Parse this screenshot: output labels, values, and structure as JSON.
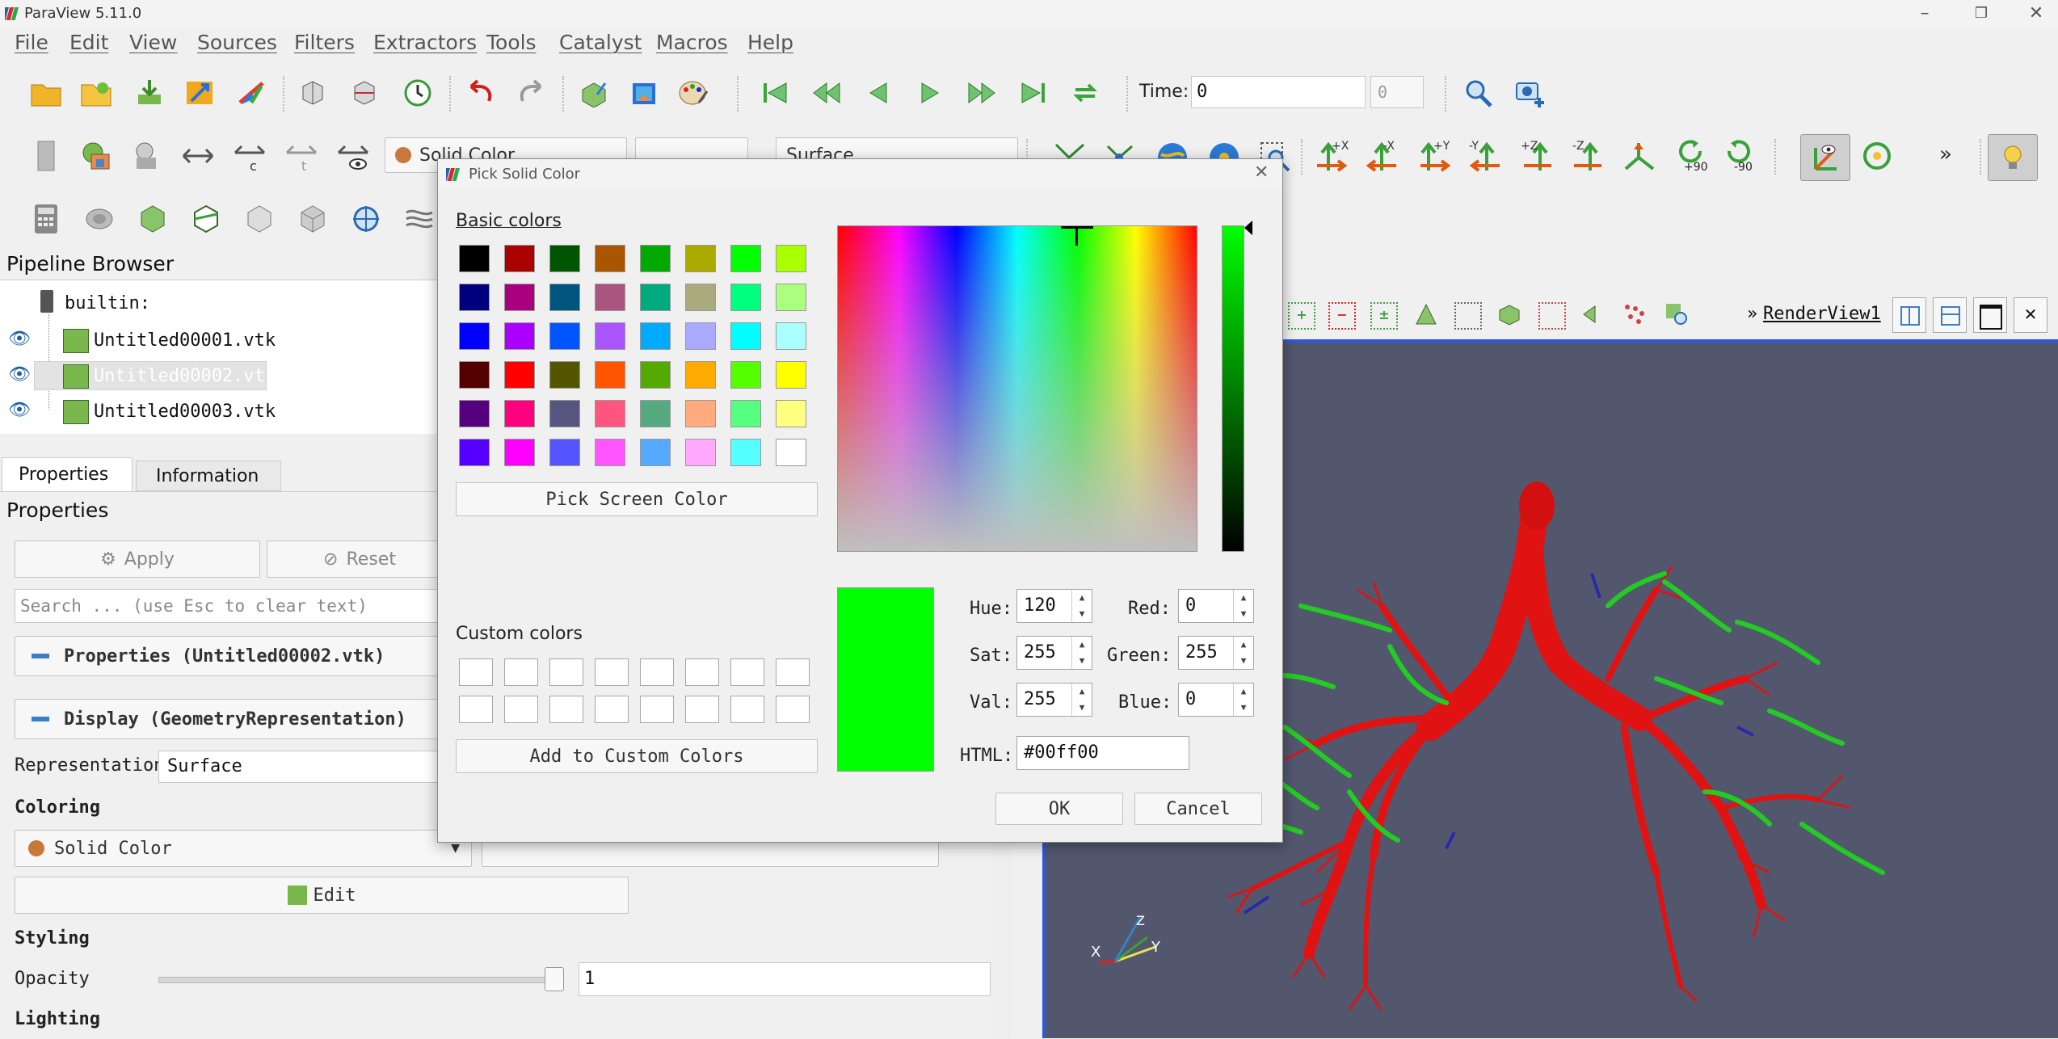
{
  "window": {
    "title": "ParaView 5.11.0"
  },
  "menu": [
    "File",
    "Edit",
    "View",
    "Sources",
    "Filters",
    "Extractors",
    "Tools",
    "Catalyst",
    "Macros",
    "Help"
  ],
  "toolbar": {
    "time_label": "Time:",
    "time_value": "0",
    "time_index": "0"
  },
  "display_toolbar": {
    "coloring": "Solid Color",
    "representation": "Surface",
    "rot_plus90": "+90",
    "rot_minus90": "-90",
    "axes": [
      "+X",
      "-X",
      "+Y",
      "-Y",
      "+Z",
      "-Z"
    ]
  },
  "pipeline": {
    "title": "Pipeline Browser",
    "root": "builtin:",
    "items": [
      "Untitled00001.vtk",
      "Untitled00002.vtk",
      "Untitled00003.vtk"
    ]
  },
  "tabs": [
    "Properties",
    "Information"
  ],
  "properties": {
    "title": "Properties",
    "apply": "Apply",
    "reset": "Reset",
    "search_placeholder": "Search ... (use Esc to clear text)",
    "section_props": "Properties (Untitled00002.vtk)",
    "section_display": "Display (GeometryRepresentation)",
    "representation_label": "Representation",
    "representation_value": "Surface",
    "coloring_label": "Coloring",
    "coloring_value": "Solid Color",
    "edit": "Edit",
    "styling_label": "Styling",
    "opacity_label": "Opacity",
    "opacity_value": "1",
    "opacity": 1.0,
    "lighting_label": "Lighting"
  },
  "render": {
    "view_name": "RenderView1",
    "axis_x": "X",
    "axis_y": "Y",
    "axis_z": "Z",
    "background": "#52576e"
  },
  "dialog": {
    "title": "Pick Solid Color",
    "basic_label": "Basic colors",
    "custom_label": "Custom colors",
    "pick_screen": "Pick Screen Color",
    "add_custom": "Add to Custom Colors",
    "hue_label": "Hue:",
    "hue": "120",
    "sat_label": "Sat:",
    "sat": "255",
    "val_label": "Val:",
    "val": "255",
    "red_label": "Red:",
    "red": "0",
    "green_label": "Green:",
    "green": "255",
    "blue_label": "Blue:",
    "blue": "0",
    "html_label": "HTML:",
    "html": "#00ff00",
    "ok": "OK",
    "cancel": "Cancel",
    "current": "#00ff00",
    "basic_colors": [
      "#000000",
      "#aa0000",
      "#005500",
      "#aa5500",
      "#00aa00",
      "#aaaa00",
      "#00ff00",
      "#aaff00",
      "#00007f",
      "#aa007f",
      "#00557f",
      "#aa557f",
      "#00aa7f",
      "#aaaa7f",
      "#00ff7f",
      "#aaff7f",
      "#0000ff",
      "#aa00ff",
      "#0055ff",
      "#aa55ff",
      "#00aaff",
      "#aaaaff",
      "#00ffff",
      "#aaffff",
      "#550000",
      "#ff0000",
      "#555500",
      "#ff5500",
      "#55aa00",
      "#ffaa00",
      "#55ff00",
      "#ffff00",
      "#55007f",
      "#ff007f",
      "#55557f",
      "#ff557f",
      "#55aa7f",
      "#ffaa7f",
      "#55ff7f",
      "#ffff7f",
      "#5500ff",
      "#ff00ff",
      "#5555ff",
      "#ff55ff",
      "#55aaff",
      "#ffaaff",
      "#55ffff",
      "#ffffff"
    ]
  }
}
